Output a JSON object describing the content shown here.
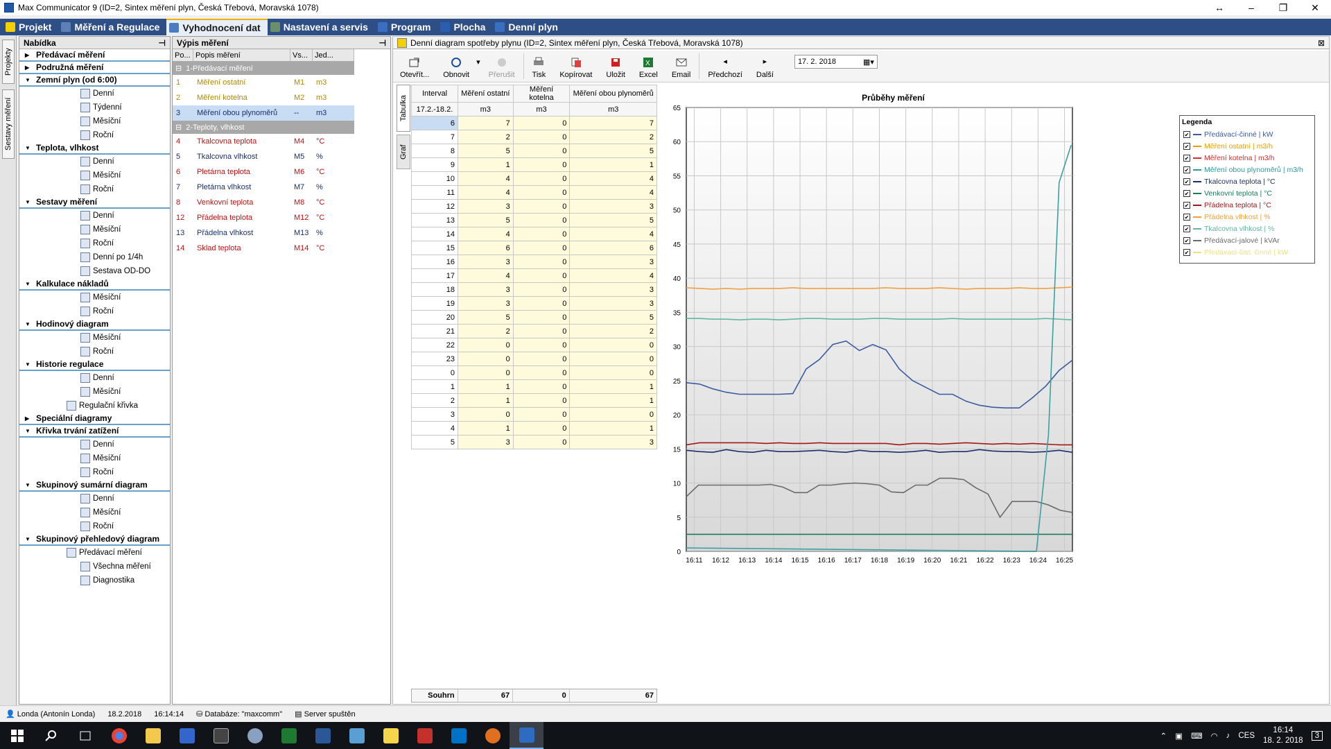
{
  "window": {
    "title": "Max Communicator 9 (ID=2, Sintex měření plyn, Česká Třebová, Moravská 1078)",
    "min": "–",
    "max": "❐",
    "close": "✕",
    "move": "↔"
  },
  "tabs": [
    {
      "label": "Projekt",
      "color": "#f5d000"
    },
    {
      "label": "Měření a Regulace",
      "color": "#5d7fb5"
    },
    {
      "label": "Vyhodnocení dat",
      "color": "#4a7dc0"
    },
    {
      "label": "Nastavení a servis",
      "color": "#6b8e6b"
    },
    {
      "label": "Program",
      "color": "#3a6fc0"
    },
    {
      "label": "Plocha",
      "color": "#2a5fb0"
    },
    {
      "label": "Denní plyn",
      "color": "#3a6fc0"
    }
  ],
  "side_tabs": {
    "projekty": "Projekty",
    "sestavy": "Sestavy měření"
  },
  "nabidka": {
    "title": "Nabídka",
    "pin": "⊣",
    "groups": [
      {
        "label": "Předávací měření",
        "expanded": false,
        "items": []
      },
      {
        "label": "Podružná měření",
        "expanded": false,
        "items": []
      },
      {
        "label": "Zemní plyn (od 6:00)",
        "expanded": true,
        "items": [
          "Denní",
          "Týdenní",
          "Měsíční",
          "Roční"
        ]
      },
      {
        "label": "Teplota, vlhkost",
        "expanded": true,
        "items": [
          "Denní",
          "Měsíční",
          "Roční"
        ]
      },
      {
        "label": "Sestavy měření",
        "expanded": true,
        "items": [
          "Denní",
          "Měsíční",
          "Roční",
          "Denní po 1/4h",
          "Sestava OD-DO"
        ]
      },
      {
        "label": "Kalkulace nákladů",
        "expanded": true,
        "items": [
          "Měsíční",
          "Roční"
        ]
      },
      {
        "label": "Hodinový diagram",
        "expanded": true,
        "items": [
          "Měsíční",
          "Roční"
        ]
      },
      {
        "label": "Historie regulace",
        "expanded": true,
        "items": [
          "Denní",
          "Měsíční",
          "Regulační křivka"
        ]
      },
      {
        "label": "Speciální diagramy",
        "expanded": false,
        "items": []
      },
      {
        "label": "Křivka trvání zatížení",
        "expanded": true,
        "items": [
          "Denní",
          "Měsíční",
          "Roční"
        ]
      },
      {
        "label": "Skupinový sumární diagram",
        "expanded": true,
        "items": [
          "Denní",
          "Měsíční",
          "Roční"
        ]
      },
      {
        "label": "Skupinový přehledový diagram",
        "expanded": true,
        "items": [
          "Předávací měření",
          "Všechna měření",
          "Diagnostika"
        ]
      }
    ]
  },
  "vypis": {
    "title": "Výpis měření",
    "pin": "⊣",
    "headers": [
      "Po...",
      "Popis měření",
      "Vs...",
      "Jed..."
    ],
    "groups": [
      {
        "label": "1-Předávací měření",
        "rows": [
          {
            "no": "1",
            "name": "Měření ostatní",
            "vs": "M1",
            "unit": "m3",
            "color": "#b08a00",
            "selected": false
          },
          {
            "no": "2",
            "name": "Měření kotelna",
            "vs": "M2",
            "unit": "m3",
            "color": "#b08a00",
            "selected": false
          },
          {
            "no": "3",
            "name": "Měření obou plynoměrů",
            "vs": "--",
            "unit": "m3",
            "color": "#1a2f6a",
            "selected": true
          }
        ]
      },
      {
        "label": "2-Teploty, vlhkost",
        "rows": [
          {
            "no": "4",
            "name": "Tkalcovna teplota",
            "vs": "M4",
            "unit": "°C",
            "color": "#c01010"
          },
          {
            "no": "5",
            "name": "Tkalcovna vlhkost",
            "vs": "M5",
            "unit": "%",
            "color": "#1a2f6a"
          },
          {
            "no": "6",
            "name": "Pletárna teplota",
            "vs": "M6",
            "unit": "°C",
            "color": "#c01010"
          },
          {
            "no": "7",
            "name": "Pletárna vlhkost",
            "vs": "M7",
            "unit": "%",
            "color": "#1a2f6a"
          },
          {
            "no": "8",
            "name": "Venkovní teplota",
            "vs": "M8",
            "unit": "°C",
            "color": "#c01010"
          },
          {
            "no": "12",
            "name": "Přádelna teplota",
            "vs": "M12",
            "unit": "°C",
            "color": "#c01010"
          },
          {
            "no": "13",
            "name": "Přádelna vlhkost",
            "vs": "M13",
            "unit": "%",
            "color": "#1a2f6a"
          },
          {
            "no": "14",
            "name": "Sklad teplota",
            "vs": "M14",
            "unit": "°C",
            "color": "#c01010"
          }
        ]
      }
    ]
  },
  "doc": {
    "title": "Denní diagram spotřeby plynu (ID=2, Sintex měření plyn, Česká Třebová, Moravská 1078)",
    "close": "⊠"
  },
  "toolbar": {
    "open": "Otevřít...",
    "refresh": "Obnovit",
    "stop": "Přerušit",
    "print": "Tisk",
    "copy": "Kopírovat",
    "save": "Uložit",
    "excel": "Excel",
    "email": "Email",
    "prev": "Předchozí",
    "next": "Další",
    "date": "17.  2. 2018"
  },
  "view_tabs": {
    "table": "Tabulka",
    "graph": "Graf"
  },
  "table": {
    "headers": [
      "Interval",
      "Měření ostatní",
      "Měření kotelna",
      "Měření obou plynoměrů"
    ],
    "subheaders": [
      "17.2.-18.2.",
      "m3",
      "m3",
      "m3"
    ],
    "rows": [
      [
        "6",
        "7",
        "0",
        "7"
      ],
      [
        "7",
        "2",
        "0",
        "2"
      ],
      [
        "8",
        "5",
        "0",
        "5"
      ],
      [
        "9",
        "1",
        "0",
        "1"
      ],
      [
        "10",
        "4",
        "0",
        "4"
      ],
      [
        "11",
        "4",
        "0",
        "4"
      ],
      [
        "12",
        "3",
        "0",
        "3"
      ],
      [
        "13",
        "5",
        "0",
        "5"
      ],
      [
        "14",
        "4",
        "0",
        "4"
      ],
      [
        "15",
        "6",
        "0",
        "6"
      ],
      [
        "16",
        "3",
        "0",
        "3"
      ],
      [
        "17",
        "4",
        "0",
        "4"
      ],
      [
        "18",
        "3",
        "0",
        "3"
      ],
      [
        "19",
        "3",
        "0",
        "3"
      ],
      [
        "20",
        "5",
        "0",
        "5"
      ],
      [
        "21",
        "2",
        "0",
        "2"
      ],
      [
        "22",
        "0",
        "0",
        "0"
      ],
      [
        "23",
        "0",
        "0",
        "0"
      ],
      [
        "0",
        "0",
        "0",
        "0"
      ],
      [
        "1",
        "1",
        "0",
        "1"
      ],
      [
        "2",
        "1",
        "0",
        "1"
      ],
      [
        "3",
        "0",
        "0",
        "0"
      ],
      [
        "4",
        "1",
        "0",
        "1"
      ],
      [
        "5",
        "3",
        "0",
        "3"
      ]
    ],
    "summary": [
      "Souhrn",
      "67",
      "0",
      "67"
    ]
  },
  "chart_data": {
    "type": "line",
    "title": "Průběhy měření",
    "x": [
      "16:11",
      "16:12",
      "16:13",
      "16:14",
      "16:15",
      "16:16",
      "16:17",
      "16:18",
      "16:19",
      "16:20",
      "16:21",
      "16:22",
      "16:23",
      "16:24",
      "16:25"
    ],
    "ylim": [
      0,
      65
    ],
    "yticks": [
      0,
      5,
      10,
      15,
      20,
      25,
      30,
      35,
      40,
      45,
      50,
      55,
      60,
      65
    ],
    "grid": true,
    "legend_position": "top-right",
    "legend_title": "Legenda",
    "series": [
      {
        "name": "Předávací-činné | kW",
        "color": "#3c5aa0",
        "values": [
          24.7,
          24.5,
          23.8,
          23.3,
          23.0,
          23.0,
          23.0,
          23.0,
          23.1,
          26.7,
          28.1,
          30.3,
          30.8,
          29.4,
          30.3,
          29.5,
          26.7,
          25.0,
          24.0,
          23.0,
          23.0,
          22.0,
          21.4,
          21.1,
          21.0,
          21.0,
          22.5,
          24.2,
          26.5,
          28.0
        ]
      },
      {
        "name": "Měření ostatní | m3/h",
        "color": "#e8a000",
        "values": []
      },
      {
        "name": "Měření kotelna | m3/h",
        "color": "#d03030",
        "values": []
      },
      {
        "name": "Měření obou plynoměrů | m3/h",
        "color": "#2a9aa0",
        "values": []
      },
      {
        "name": "Tkalcovna teplota | °C",
        "color": "#1a2f6a",
        "values": [
          14.8,
          14.6,
          14.5,
          14.9,
          14.6,
          14.5,
          14.8,
          14.6,
          14.6,
          14.7,
          14.8,
          14.6,
          14.5,
          14.8,
          14.6,
          14.6,
          14.5,
          14.6,
          14.8,
          14.5,
          14.6,
          14.6,
          14.9,
          14.7,
          14.6,
          14.6,
          14.5,
          14.6,
          14.8,
          14.5
        ]
      },
      {
        "name": "Venkovní teplota | °C",
        "color": "#1a7a5a",
        "values": [
          2.5,
          2.5,
          2.5,
          2.5,
          2.5,
          2.5,
          2.5,
          2.5,
          2.5,
          2.5,
          2.5,
          2.5,
          2.5,
          2.5,
          2.5,
          2.5,
          2.5,
          2.5,
          2.5,
          2.5,
          2.5,
          2.5,
          2.5,
          2.5,
          2.5,
          2.5,
          2.5,
          2.5,
          2.5,
          2.5
        ]
      },
      {
        "name": "Přádelna teplota | °C",
        "color": "#a01818",
        "values": [
          15.6,
          15.9,
          15.9,
          15.9,
          15.9,
          15.9,
          15.8,
          15.9,
          15.8,
          15.8,
          15.9,
          15.8,
          15.8,
          15.8,
          15.8,
          15.8,
          15.6,
          15.8,
          15.8,
          15.7,
          15.8,
          15.9,
          15.8,
          15.7,
          15.8,
          15.7,
          15.8,
          15.7,
          15.6,
          15.6
        ]
      },
      {
        "name": "Přádelna vlhkost | %",
        "color": "#f0a040",
        "values": [
          38.6,
          38.5,
          38.4,
          38.5,
          38.4,
          38.5,
          38.5,
          38.5,
          38.6,
          38.5,
          38.5,
          38.5,
          38.5,
          38.5,
          38.5,
          38.6,
          38.5,
          38.5,
          38.5,
          38.6,
          38.5,
          38.4,
          38.5,
          38.5,
          38.5,
          38.6,
          38.5,
          38.5,
          38.6,
          38.7
        ]
      },
      {
        "name": "Tkalcovna vlhkost | %",
        "color": "#60b8a0",
        "values": [
          34.1,
          34.1,
          34.0,
          34.0,
          33.9,
          34.0,
          34.0,
          33.9,
          34.0,
          34.1,
          34.1,
          34.0,
          34.0,
          34.0,
          34.1,
          34.1,
          34.0,
          34.0,
          34.0,
          34.0,
          34.1,
          34.0,
          34.0,
          34.0,
          34.0,
          34.0,
          34.0,
          34.1,
          34.0,
          33.9
        ]
      },
      {
        "name": "Předávací-jalové | kVAr",
        "color": "#6a6a6a",
        "values": [
          8.0,
          9.7,
          9.7,
          9.7,
          9.7,
          9.7,
          9.7,
          9.8,
          9.4,
          8.6,
          8.6,
          9.7,
          9.7,
          9.9,
          10.0,
          9.9,
          9.7,
          8.7,
          8.6,
          9.7,
          9.7,
          10.7,
          10.7,
          10.5,
          9.3,
          8.4,
          5.0,
          7.3,
          7.3,
          7.3,
          6.8,
          6.0,
          5.7
        ]
      },
      {
        "name": "Předávací-čist. činné | kW",
        "color": "#f0e080",
        "values": []
      }
    ],
    "steep_series": {
      "name": "Měření obou plynoměrů | m3/h",
      "points": [
        [
          0,
          0.5
        ],
        [
          26,
          0
        ],
        [
          26.3,
          0
        ],
        [
          27.2,
          17
        ],
        [
          28,
          54
        ],
        [
          28.9,
          59.5
        ]
      ]
    },
    "gray_points_first": true
  },
  "statusbar": {
    "user": "Londa (Antonín Londa)",
    "date": "18.2.2018",
    "time": "16:14:14",
    "db": "Databáze: \"maxcomm\"",
    "server": "Server spuštěn"
  },
  "taskbar": {
    "time": "16:14",
    "date": "18. 2. 2018",
    "lang": "CES",
    "notif": "3"
  }
}
